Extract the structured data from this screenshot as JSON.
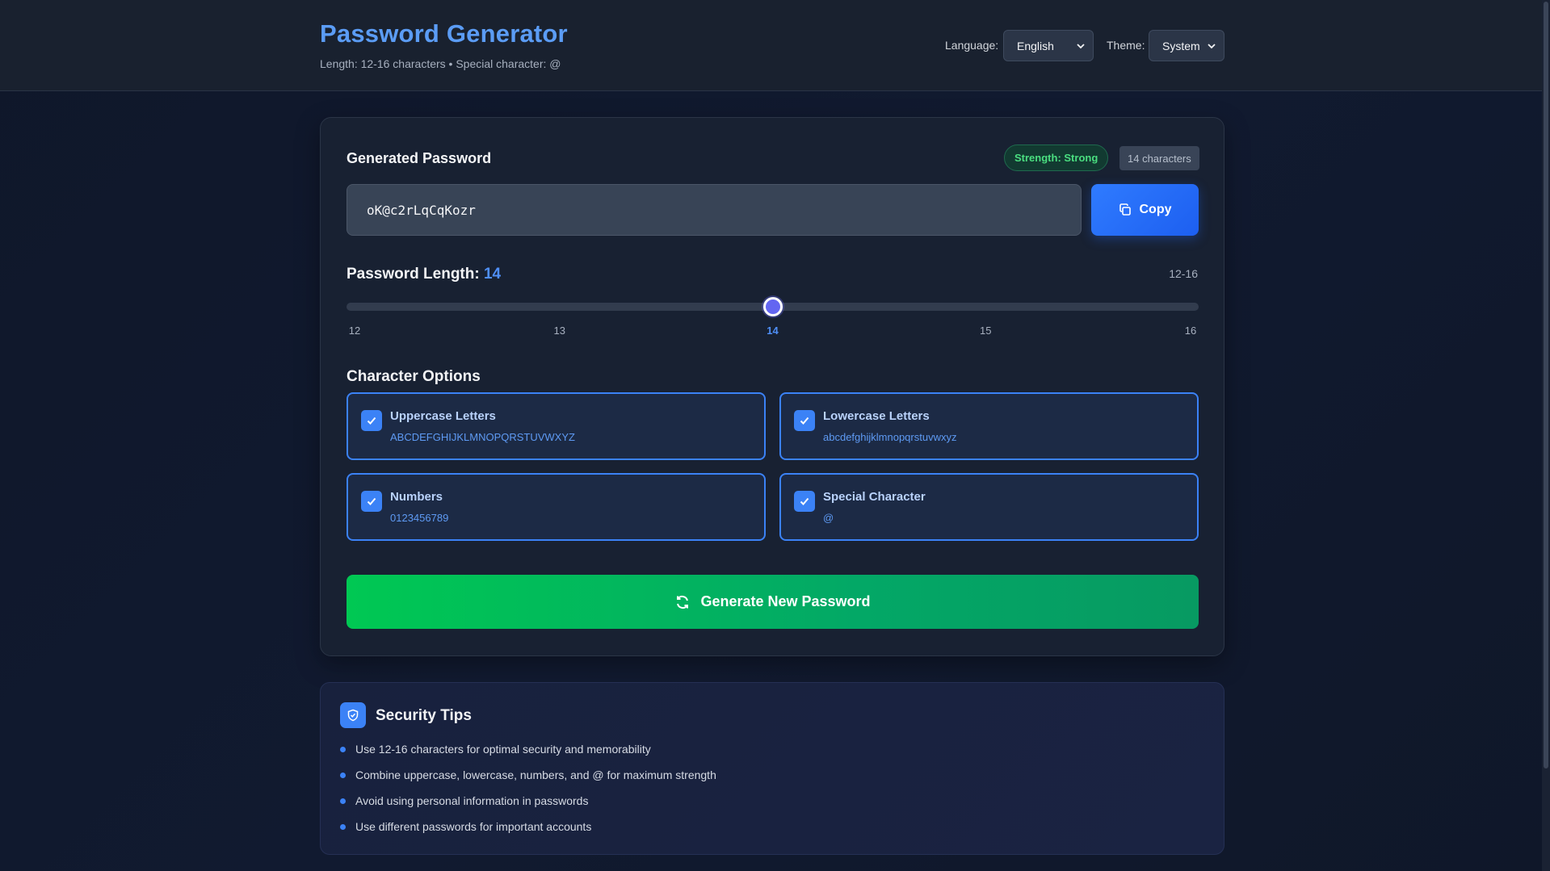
{
  "header": {
    "title": "Password Generator",
    "subtitle": "Length: 12-16 characters • Special character: @",
    "language_label": "Language:",
    "language_value": "English",
    "theme_label": "Theme:",
    "theme_value": "System"
  },
  "generator": {
    "heading": "Generated Password",
    "strength_badge": "Strength: Strong",
    "chars_badge": "14 characters",
    "password": "oK@c2rLqCqKozr",
    "copy_label": "Copy"
  },
  "length": {
    "label": "Password Length:",
    "value": "14",
    "range_label": "12-16",
    "min": 12,
    "max": 16,
    "current": 14,
    "ticks": [
      "12",
      "13",
      "14",
      "15",
      "16"
    ]
  },
  "options": {
    "heading": "Character Options",
    "items": [
      {
        "title": "Uppercase Letters",
        "sample": "ABCDEFGHIJKLMNOPQRSTUVWXYZ",
        "checked": true
      },
      {
        "title": "Lowercase Letters",
        "sample": "abcdefghijklmnopqrstuvwxyz",
        "checked": true
      },
      {
        "title": "Numbers",
        "sample": "0123456789",
        "checked": true
      },
      {
        "title": "Special Character",
        "sample": "@",
        "checked": true
      }
    ]
  },
  "generate_label": "Generate New Password",
  "tips": {
    "title": "Security Tips",
    "items": [
      "Use 12-16 characters for optimal security and memorability",
      "Combine uppercase, lowercase, numbers, and @ for maximum strength",
      "Avoid using personal information in passwords",
      "Use different passwords for important accounts"
    ]
  },
  "colors": {
    "accent": "#3b82f6",
    "title": "#5b9cf5",
    "success": "#00c853",
    "strength": "#4ade80",
    "slider_thumb": "#6366f1"
  },
  "icons": {
    "copy": "copy-icon",
    "refresh": "refresh-icon",
    "check": "check-icon",
    "shield": "shield-icon",
    "chevron": "chevron-down-icon"
  }
}
